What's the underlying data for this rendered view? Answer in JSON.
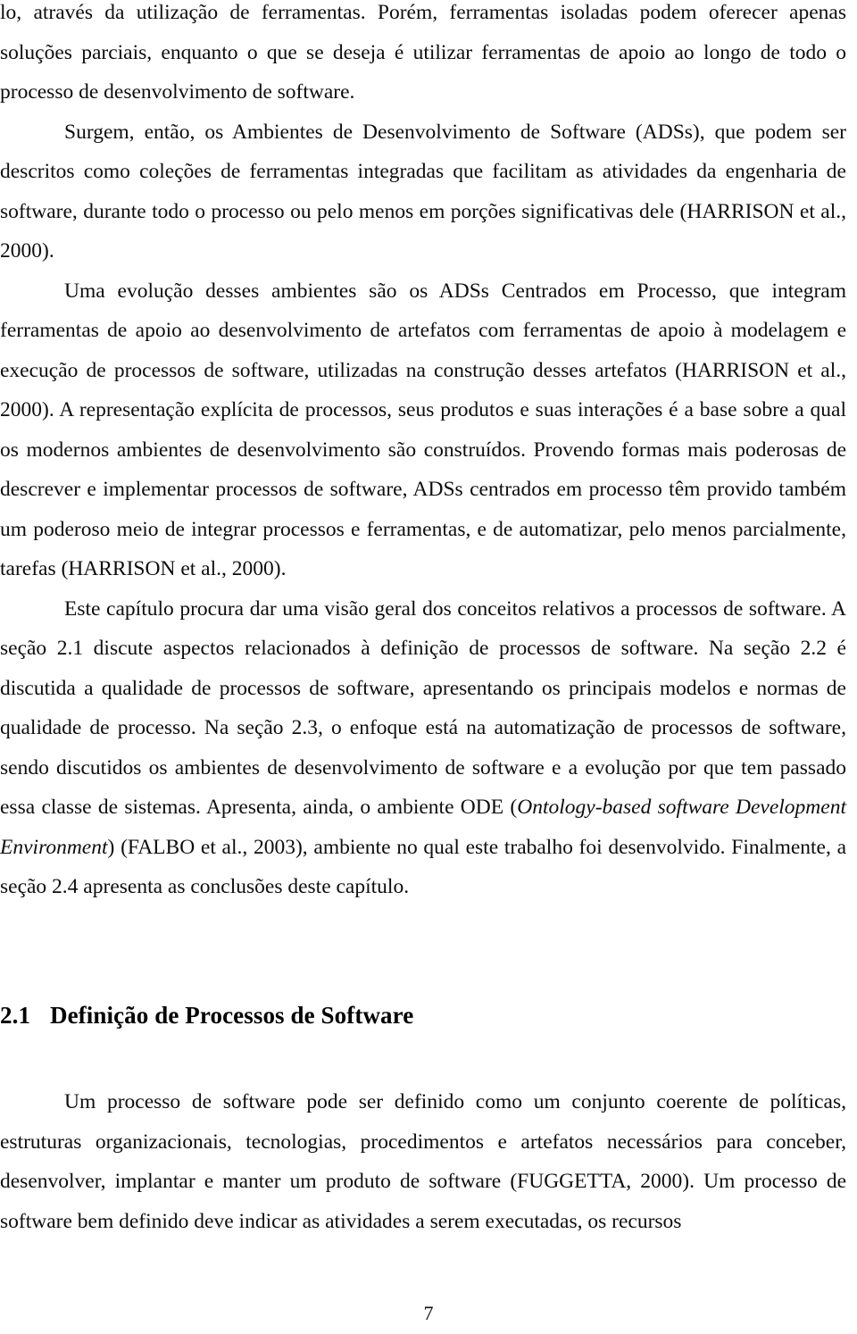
{
  "document": {
    "language": "pt-BR",
    "page_number": "7",
    "paragraphs": [
      {
        "id": "p1",
        "continuation": true,
        "text": "lo, através da utilização de ferramentas. Porém, ferramentas isoladas podem oferecer apenas soluções parciais, enquanto o que se deseja é utilizar ferramentas de apoio ao longo de todo o processo de desenvolvimento de software."
      },
      {
        "id": "p2",
        "continuation": false,
        "text": "Surgem, então, os Ambientes de Desenvolvimento de Software (ADSs), que podem ser descritos como coleções de ferramentas integradas que facilitam as atividades da engenharia de software, durante todo o processo ou pelo menos em porções significativas dele (HARRISON et al., 2000)."
      },
      {
        "id": "p3",
        "continuation": false,
        "text": "Uma evolução desses ambientes são os ADSs Centrados em Processo, que integram ferramentas de apoio ao desenvolvimento de artefatos com ferramentas de apoio à modelagem e execução de processos de software, utilizadas na construção desses artefatos (HARRISON et al., 2000). A representação explícita de processos, seus produtos e suas interações é a base sobre a qual os modernos ambientes de desenvolvimento são construídos.  Provendo formas mais poderosas de descrever e implementar processos de software, ADSs centrados em processo têm provido também um poderoso meio de integrar processos e ferramentas, e de automatizar, pelo menos parcialmente, tarefas (HARRISON et al., 2000)."
      },
      {
        "id": "p4",
        "continuation": false,
        "text_part1": "Este capítulo procura dar uma visão geral dos conceitos relativos a processos de software. A seção 2.1 discute aspectos relacionados à definição de processos de software. Na seção 2.2 é discutida a qualidade de processos de software, apresentando os principais modelos e normas de qualidade de processo. Na seção 2.3, o enfoque está na automatização de processos de software, sendo discutidos os ambientes de desenvolvimento de software e a evolução por que tem passado essa classe de sistemas. Apresenta, ainda, o ambiente ODE (",
        "text_italic": "Ontology-based software Development Environment",
        "text_part2": ") (FALBO et al., 2003), ambiente no qual este trabalho foi desenvolvido. Finalmente, a seção 2.4 apresenta as conclusões deste capítulo."
      }
    ],
    "heading": {
      "number": "2.1",
      "title": "Definição de Processos de Software"
    },
    "paragraphs_after_heading": [
      {
        "id": "p5",
        "continuation": false,
        "text": "Um processo de software pode ser definido como um conjunto coerente de políticas, estruturas organizacionais, tecnologias, procedimentos e artefatos necessários para conceber, desenvolver, implantar e manter um produto de software (FUGGETTA, 2000). Um processo de software bem definido deve indicar as atividades a serem executadas, os recursos"
      }
    ]
  }
}
